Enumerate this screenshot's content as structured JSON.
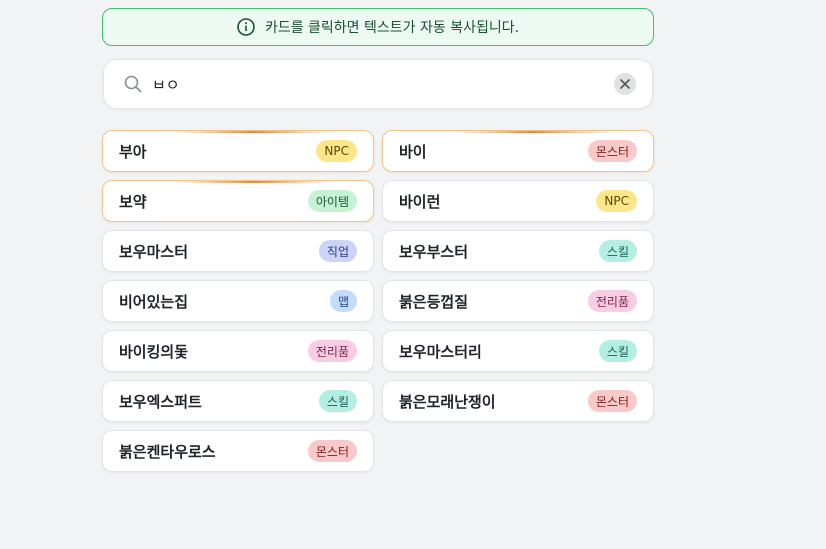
{
  "notice": {
    "text": "카드를 클릭하면 텍스트가 자동 복사됩니다."
  },
  "search": {
    "value": "ㅂㅇ"
  },
  "cards": [
    {
      "name": "부아",
      "tag": "NPC",
      "kind": "npc",
      "hot": true
    },
    {
      "name": "바이",
      "tag": "몬스터",
      "kind": "mon",
      "hot": true
    },
    {
      "name": "보약",
      "tag": "아이템",
      "kind": "item",
      "hot": true
    },
    {
      "name": "바이런",
      "tag": "NPC",
      "kind": "npc",
      "hot": false
    },
    {
      "name": "보우마스터",
      "tag": "직업",
      "kind": "job",
      "hot": false
    },
    {
      "name": "보우부스터",
      "tag": "스킬",
      "kind": "skill",
      "hot": false
    },
    {
      "name": "비어있는집",
      "tag": "맵",
      "kind": "map",
      "hot": false
    },
    {
      "name": "붉은등껍질",
      "tag": "전리품",
      "kind": "loot",
      "hot": false
    },
    {
      "name": "바이킹의돛",
      "tag": "전리품",
      "kind": "loot",
      "hot": false
    },
    {
      "name": "보우마스터리",
      "tag": "스킬",
      "kind": "skill",
      "hot": false
    },
    {
      "name": "보우엑스퍼트",
      "tag": "스킬",
      "kind": "skill",
      "hot": false
    },
    {
      "name": "붉은모래난쟁이",
      "tag": "몬스터",
      "kind": "mon",
      "hot": false
    },
    {
      "name": "붉은켄타우로스",
      "tag": "몬스터",
      "kind": "mon",
      "hot": false
    }
  ]
}
